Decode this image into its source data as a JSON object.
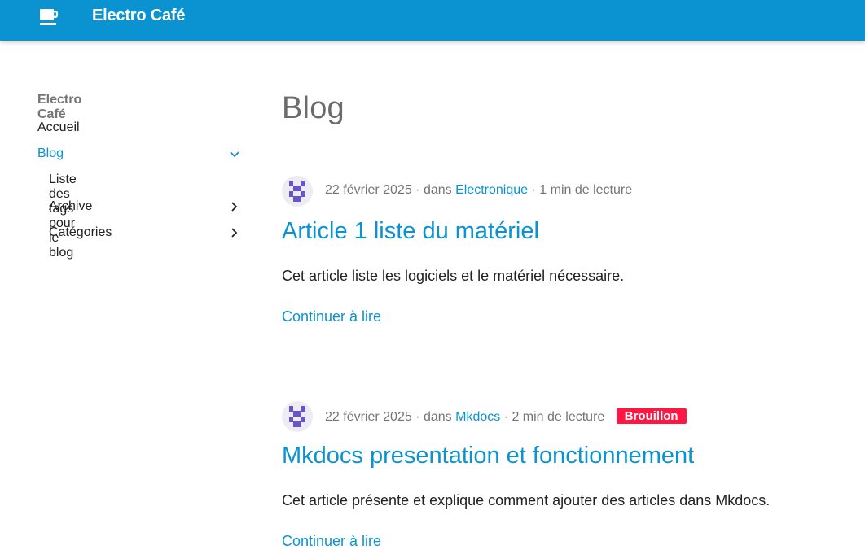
{
  "header": {
    "site_title": "Electro Café",
    "logo_icon": "coffee-cup-icon",
    "color": "#0b93d1"
  },
  "sidebar": {
    "title": "Electro Café",
    "items": [
      {
        "label": "Accueil"
      },
      {
        "label": "Blog",
        "active": true,
        "expanded": true
      },
      {
        "label": "Liste des tags pour le blog"
      },
      {
        "label": "Archive"
      },
      {
        "label": "Catégories"
      }
    ]
  },
  "main": {
    "title": "Blog",
    "posts": [
      {
        "date": "22 février 2025",
        "in_text": "dans",
        "category": "Electronique",
        "reading_time": "1 min de lecture",
        "title": "Article 1 liste du matériel",
        "excerpt": "Cet article liste les logiciels et le matériel nécessaire.",
        "read_more": "Continuer à lire"
      },
      {
        "date": "22 février 2025",
        "in_text": "dans",
        "category": "Mkdocs",
        "reading_time": "2 min de lecture",
        "badge": "Brouillon",
        "title": "Mkdocs presentation et fonctionnement",
        "excerpt": "Cet article présente et explique comment ajouter des articles dans Mkdocs.",
        "read_more": "Continuer à lire"
      }
    ]
  },
  "colors": {
    "accent": "#0b93d1",
    "badge": "#ff1744",
    "avatar": "#6a55c8"
  }
}
